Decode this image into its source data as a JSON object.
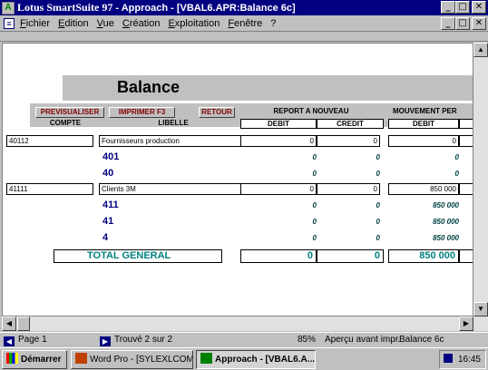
{
  "window": {
    "brand": "Lotus SmartSuite 97",
    "title": " -  Approach - [VBAL6.APR:Balance 6c]",
    "min": "_",
    "max": "□",
    "close": "✕"
  },
  "menu": [
    "Fichier",
    "Edition",
    "Vue",
    "Création",
    "Exploitation",
    "Fenêtre",
    "?"
  ],
  "report": {
    "heading": "Balance",
    "buttons": {
      "preview": "PREVISUALISER",
      "print": "IMPRIMER F3",
      "back": "RETOUR"
    },
    "group_headers": {
      "report": "REPORT A NOUVEAU",
      "movement": "MOUVEMENT PER"
    },
    "columns": {
      "compte": "COMPTE",
      "libelle": "LIBELLE",
      "debit1": "DEBIT",
      "credit1": "CREDIT",
      "debit2": "DEBIT"
    },
    "rows": [
      {
        "compte": "40112",
        "libelle": "Fournisseurs production",
        "debit": "0",
        "credit": "0",
        "mvt_debit": "0"
      },
      {
        "compte": "41111",
        "libelle": "Clients 3M",
        "debit": "0",
        "credit": "0",
        "mvt_debit": "850 000"
      }
    ],
    "subtotals_a": [
      {
        "code": "401",
        "debit": "0",
        "credit": "0",
        "mvt_debit": "0"
      },
      {
        "code": "40",
        "debit": "0",
        "credit": "0",
        "mvt_debit": "0"
      }
    ],
    "subtotals_b": [
      {
        "code": "411",
        "debit": "0",
        "credit": "0",
        "mvt_debit": "850 000"
      },
      {
        "code": "41",
        "debit": "0",
        "credit": "0",
        "mvt_debit": "850 000"
      },
      {
        "code": "4",
        "debit": "0",
        "credit": "0",
        "mvt_debit": "850 000"
      }
    ],
    "total": {
      "label": "TOTAL GENERAL",
      "debit": "0",
      "credit": "0",
      "mvt_debit": "850 000"
    }
  },
  "status": {
    "page": "Page 1",
    "found": "Trouvé 2 sur 2",
    "zoom": "85%",
    "mode": "Aperçu avant impr.",
    "view": "Balance 6c"
  },
  "taskbar": {
    "start": "Démarrer",
    "task1": "Word Pro - [SYLEXLCOM...",
    "task2": "Approach - [VBAL6.A...",
    "clock": "16:45"
  }
}
